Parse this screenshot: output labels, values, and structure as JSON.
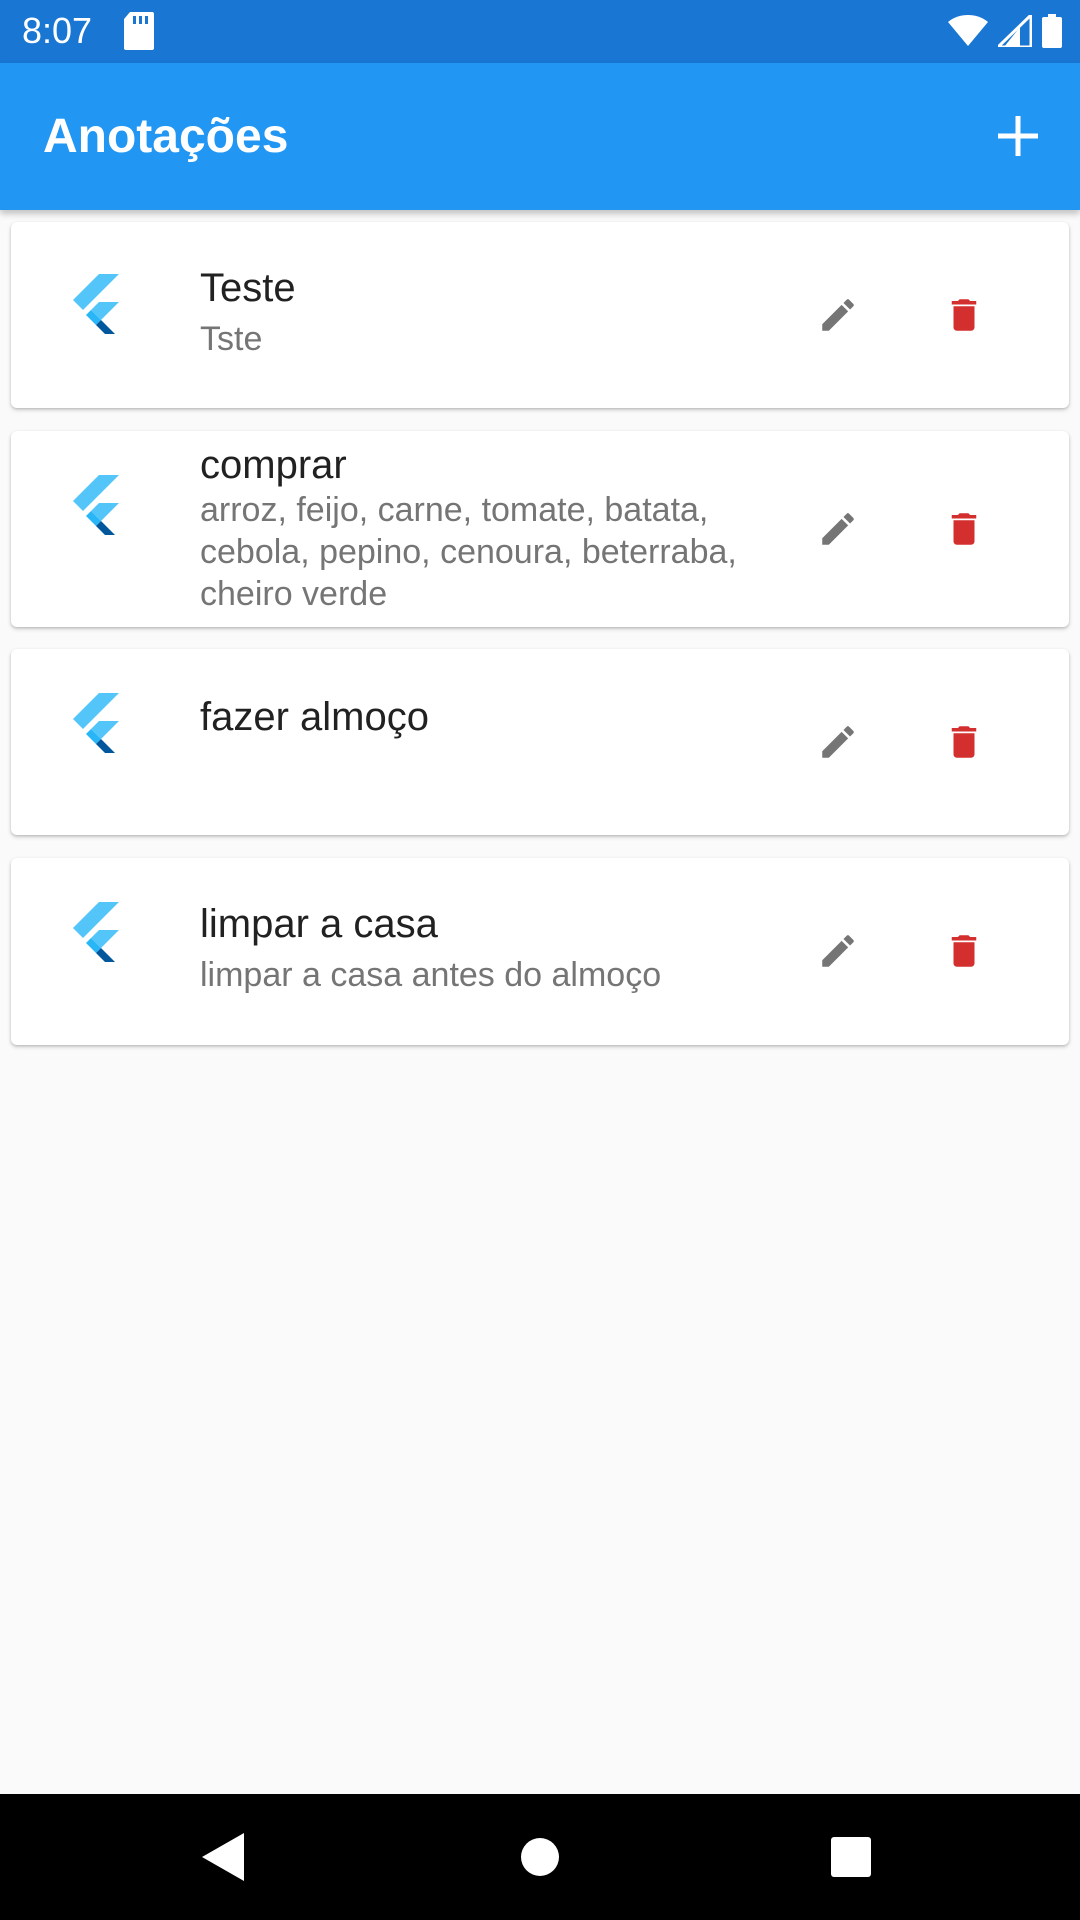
{
  "status_bar": {
    "time": "8:07",
    "icons": [
      "sd-card-icon",
      "wifi-icon",
      "signal-icon",
      "battery-icon"
    ]
  },
  "app_bar": {
    "title": "Anotações",
    "add_icon": "plus-icon",
    "color": "#2196f3"
  },
  "notes": [
    {
      "title": "Teste",
      "description": "Tste"
    },
    {
      "title": "comprar",
      "description": "arroz, feijo, carne, tomate, batata, cebola, pepino, cenoura, beterraba, cheiro verde"
    },
    {
      "title": "fazer almoço",
      "description": ""
    },
    {
      "title": "limpar a casa",
      "description": "limpar a casa antes do almoço"
    }
  ],
  "colors": {
    "status_bar": "#1976d2",
    "delete": "#d32f2f",
    "edit": "#757575"
  },
  "nav_bar": {
    "buttons": [
      "back-icon",
      "home-icon",
      "recents-icon"
    ]
  }
}
